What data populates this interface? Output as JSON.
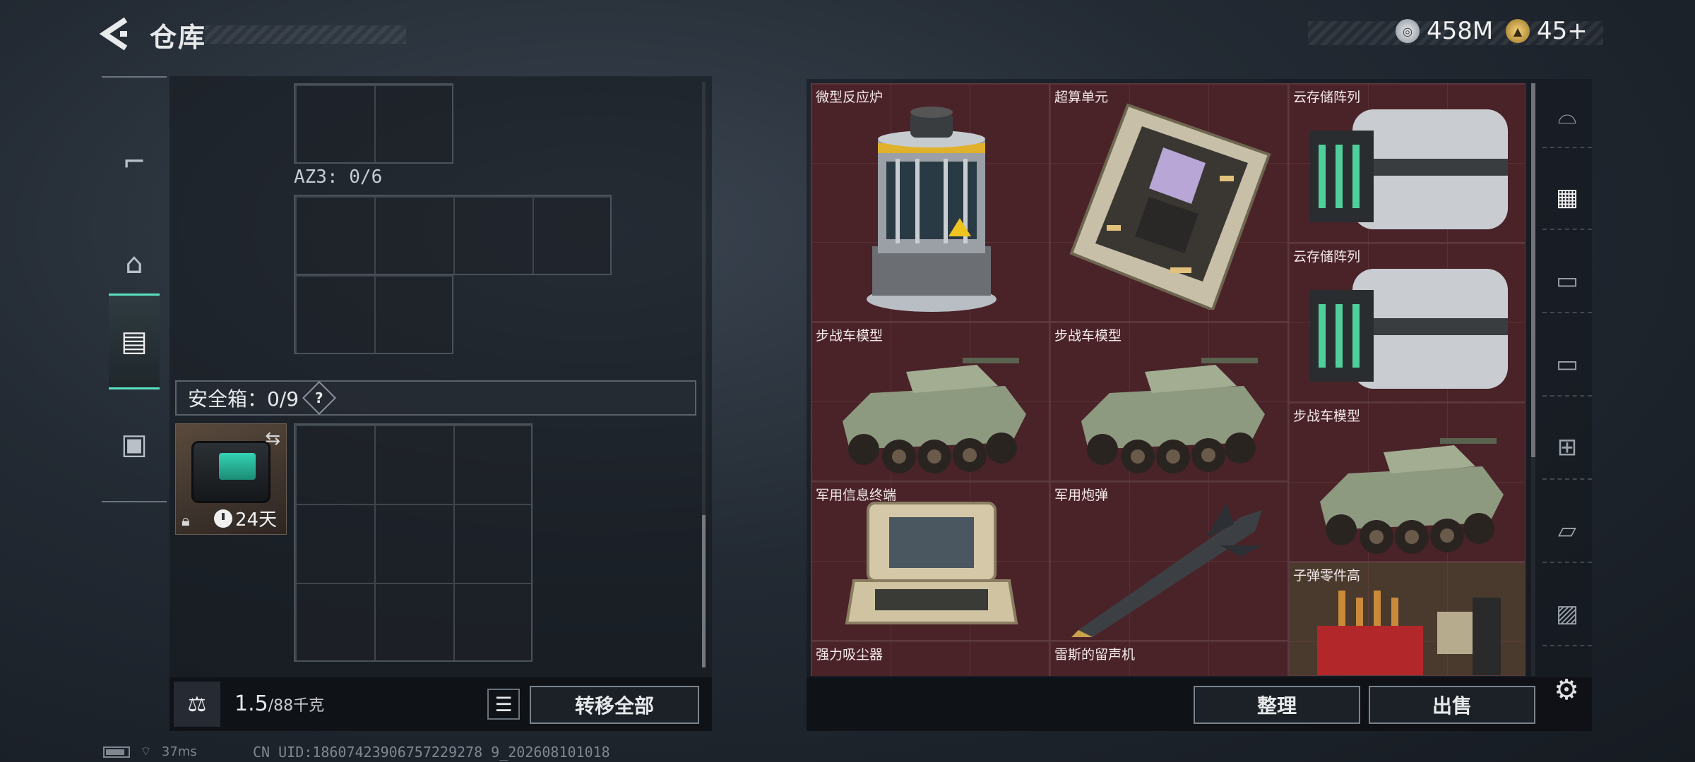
{
  "header": {
    "title": "仓库"
  },
  "currency": [
    {
      "icon": "silver-coin-icon",
      "value": "458M",
      "color": "#c8ccd2"
    },
    {
      "icon": "gold-triangle-coin-icon",
      "value": "45+",
      "color": "#d6a642"
    }
  ],
  "left_rail": [
    {
      "icon": "pistol-icon",
      "active": false
    },
    {
      "icon": "backpack-icon",
      "active": false
    },
    {
      "icon": "vest-icon",
      "active": true
    },
    {
      "icon": "briefcase-icon",
      "active": false
    }
  ],
  "storage": {
    "az3_label": "AZ3: 0/6",
    "safe_box_label": "安全箱：0/9",
    "help": "?",
    "safe_box_item": {
      "timer": "24天"
    }
  },
  "left_footer": {
    "weight_value": "1.5",
    "weight_max": "/88千克",
    "transfer_all": "转移全部"
  },
  "inventory": {
    "items": [
      {
        "name": "微型反应炉",
        "art": "reactor"
      },
      {
        "name": "超算单元",
        "art": "board"
      },
      {
        "name": "云存储阵列",
        "art": "server"
      },
      {
        "name": "云存储阵列",
        "art": "server"
      },
      {
        "name": "步战车模型",
        "art": "ifv"
      },
      {
        "name": "步战车模型",
        "art": "ifv"
      },
      {
        "name": "步战车模型",
        "art": "ifv"
      },
      {
        "name": "军用信息终端",
        "art": "terminal"
      },
      {
        "name": "军用炮弹",
        "art": "missile"
      },
      {
        "name": "子弹零件高",
        "art": "ammo"
      },
      {
        "name": "强力吸尘器",
        "art": "none"
      },
      {
        "name": "雷斯的留声机",
        "art": "none"
      }
    ]
  },
  "right_footer": {
    "sort": "整理",
    "sell": "出售"
  },
  "right_rail": [
    {
      "icon": "arch-icon"
    },
    {
      "icon": "cash-register-icon",
      "selected": true
    },
    {
      "icon": "folder-iv-icon"
    },
    {
      "icon": "folder-iv-icon"
    },
    {
      "icon": "folder-add-iv-icon"
    },
    {
      "icon": "folder-open-iv-icon"
    },
    {
      "icon": "folder-photo-iv-icon"
    }
  ],
  "status_bar": {
    "ping": "37ms",
    "uid": "CN UID:18607423906757229278 9_202608101018"
  }
}
